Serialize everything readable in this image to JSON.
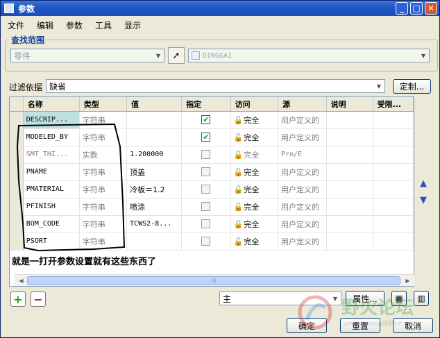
{
  "window": {
    "title": "参数"
  },
  "menu": [
    "文件",
    "编辑",
    "参数",
    "工具",
    "显示"
  ],
  "search_scope": {
    "legend": "查找范围",
    "object_type": "零件",
    "object_name": "DINGGAI"
  },
  "filter": {
    "label": "过滤依据",
    "value": "缺省",
    "customize_button": "定制..."
  },
  "table": {
    "columns": [
      "名称",
      "类型",
      "值",
      "指定",
      "访问",
      "源",
      "说明",
      "受限..."
    ],
    "rows": [
      {
        "name": "DESCRIP...",
        "type": "字符串",
        "value": "",
        "designated": true,
        "access": "完全",
        "source": "用户定义的",
        "disabled": false,
        "selected": true
      },
      {
        "name": "MODELED_BY",
        "type": "字符串",
        "value": "",
        "designated": true,
        "access": "完全",
        "source": "用户定义的",
        "disabled": false,
        "selected": false
      },
      {
        "name": "SMT_THI...",
        "type": "实数",
        "value": "1.200000",
        "designated": false,
        "access": "完全",
        "source": "Pro/E",
        "disabled": true,
        "selected": false
      },
      {
        "name": "PNAME",
        "type": "字符串",
        "value": "顶盖",
        "designated": false,
        "access": "完全",
        "source": "用户定义的",
        "disabled": false,
        "selected": false
      },
      {
        "name": "PMATERIAL",
        "type": "字符串",
        "value": "冷板＝1.2",
        "designated": false,
        "access": "完全",
        "source": "用户定义的",
        "disabled": false,
        "selected": false
      },
      {
        "name": "PFINISH",
        "type": "字符串",
        "value": "喷涂",
        "designated": false,
        "access": "完全",
        "source": "用户定义的",
        "disabled": false,
        "selected": false
      },
      {
        "name": "BOM_CODE",
        "type": "字符串",
        "value": "TCWS2-8...",
        "designated": false,
        "access": "完全",
        "source": "用户定义的",
        "disabled": false,
        "selected": false
      },
      {
        "name": "PSORT",
        "type": "字符串",
        "value": "",
        "designated": false,
        "access": "完全",
        "source": "用户定义的",
        "disabled": false,
        "selected": false
      }
    ]
  },
  "annotation": "就是一打开参数设置就有这些东西了",
  "bottom": {
    "add_label": "+",
    "remove_label": "−",
    "scope_value": "主",
    "properties_button": "属性...",
    "ok_button": "确定",
    "reset_button": "重置",
    "cancel_button": "取消"
  },
  "watermark": {
    "text": "野火论坛",
    "url": "www.proewildfire.cn"
  }
}
